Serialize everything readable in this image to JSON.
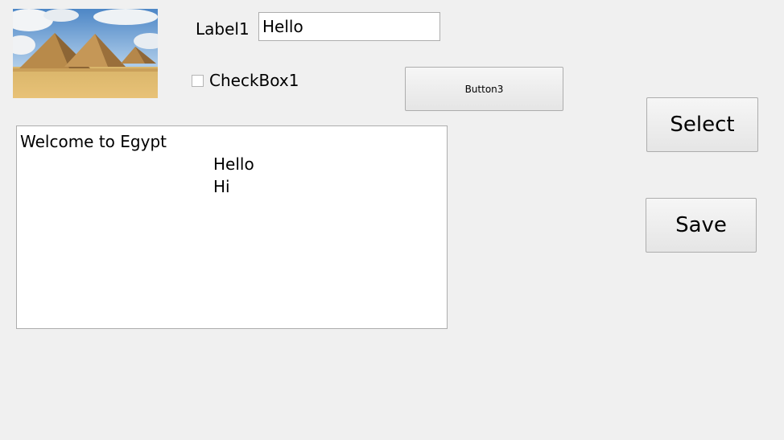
{
  "form": {
    "label1": "Label1",
    "textbox1_value": "Hello",
    "checkbox1_label": "CheckBox1",
    "checkbox1_checked": false,
    "button3_label": "Button3",
    "select_label": "Select",
    "save_label": "Save",
    "picture_icon": "pyramids-photo",
    "textarea_lines": [
      "Welcome to Egypt",
      "Hello",
      "Hi"
    ]
  }
}
